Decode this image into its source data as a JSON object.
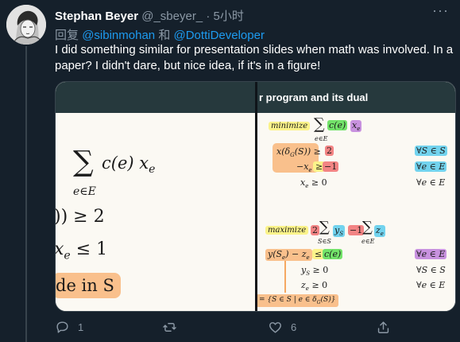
{
  "tweet": {
    "author_name": "Stephan Beyer",
    "handle": "@_sbeyer_",
    "separator": "·",
    "time": "5小时",
    "more": "···",
    "reply_prefix": "回复",
    "reply_mention_1": "@sibinmohan",
    "reply_and": "和",
    "reply_mention_2": "@DottiDeveloper",
    "text": "I did something similar for presentation slides when math was involved. In a paper? I didn't dare, but nice idea, if it's in a figure!"
  },
  "media": {
    "left": {
      "sum_expr": "c(e) x",
      "sum_sub_e": "e",
      "sum_under": "e∈E",
      "line2": ")) ≥ 2",
      "line3": "x",
      "line3_sub": "e",
      "line3_rest": " ≤ 1",
      "line4": "de in S"
    },
    "right": {
      "title": "r program and its dual",
      "primal": {
        "minimize": "minimize",
        "sum_under": "e∈E",
        "c_e": "c(e)",
        "x_e": "x",
        "x_e_sub": "e",
        "c1_lhs": "x(δ",
        "c1_lhs_sub": "G",
        "c1_lhs_rest": "(S)) ≥",
        "c1_rhs": "2",
        "c1_q": "∀S ∈ S",
        "c2_lhs": "−x",
        "c2_lhs_sub": "e",
        "c2_op": "≥",
        "c2_rhs": "−1",
        "c2_q": "∀e ∈ E",
        "c3_lhs": "x",
        "c3_lhs_sub": "e",
        "c3_rest": " ≥ 0",
        "c3_q": "∀e ∈ E"
      },
      "dual": {
        "maximize": "maximize",
        "two": "2",
        "sum1_under": "S∈S",
        "y_s": "y",
        "y_s_sub": "S",
        "minus1": "−1",
        "sum2_under": "e∈E",
        "z_e": "z",
        "z_e_sub": "e",
        "c1_lhs": "y(S",
        "c1_lhs_sub": "e",
        "c1_mid": ") − z",
        "c1_mid_sub": "e",
        "c1_op": "≤",
        "c1_rhs": "c(e)",
        "c1_q": "∀e ∈ E",
        "c2_lhs": "y",
        "c2_lhs_sub": "S",
        "c2_rest": " ≥ 0",
        "c2_q": "∀S ∈ S",
        "c3_lhs": "z",
        "c3_lhs_sub": "e",
        "c3_rest": " ≥ 0",
        "c3_q": "∀e ∈ E",
        "footnote": "= {S ∈ S | e ∈ δ",
        "footnote_sub": "G",
        "footnote_rest": "(S)}"
      }
    }
  },
  "actions": {
    "reply_count": "1",
    "retweet_count": "",
    "like_count": "6"
  },
  "colors": {
    "background": "#15202b",
    "link": "#1d9bf0",
    "muted": "#8b98a5"
  }
}
